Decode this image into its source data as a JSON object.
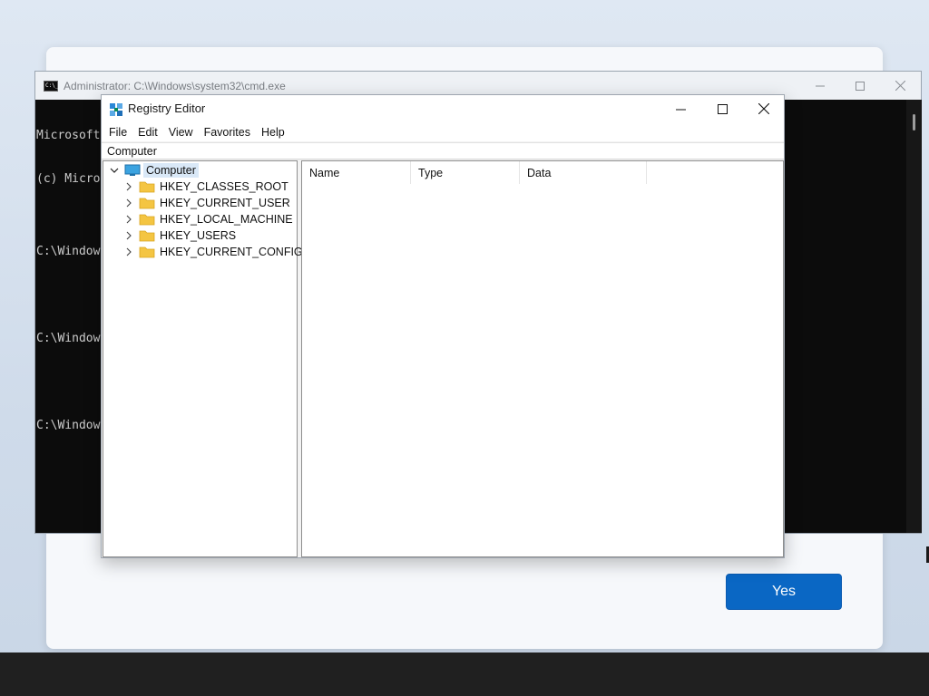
{
  "cmd": {
    "title": "Administrator: C:\\Windows\\system32\\cmd.exe",
    "lines": [
      "Microsoft",
      "(c) Micro",
      "",
      "C:\\Window",
      "",
      "C:\\Window",
      "",
      "C:\\Window"
    ]
  },
  "regedit": {
    "title": "Registry Editor",
    "menu": [
      "File",
      "Edit",
      "View",
      "Favorites",
      "Help"
    ],
    "address": "Computer",
    "tree": {
      "root": "Computer",
      "keys": [
        "HKEY_CLASSES_ROOT",
        "HKEY_CURRENT_USER",
        "HKEY_LOCAL_MACHINE",
        "HKEY_USERS",
        "HKEY_CURRENT_CONFIG"
      ]
    },
    "columns": [
      "Name",
      "Type",
      "Data"
    ]
  },
  "oobe": {
    "yes_label": "Yes",
    "accent": "#0a67c4"
  },
  "icons": {
    "cmd": "command-prompt-icon",
    "regedit": "registry-editor-icon",
    "computer": "computer-icon",
    "folder": "folder-icon"
  }
}
